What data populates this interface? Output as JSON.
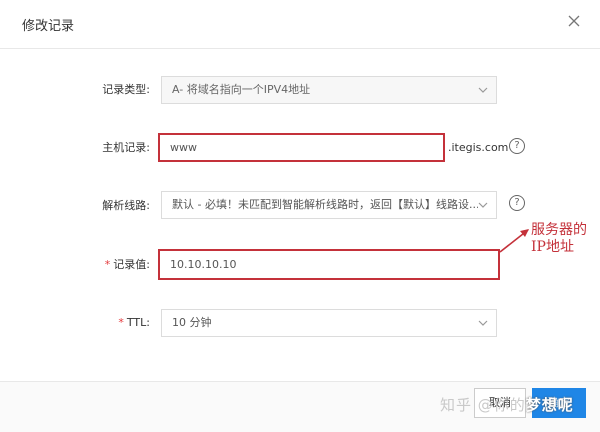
{
  "dialog": {
    "title": "修改记录",
    "close_icon": "close-icon"
  },
  "form": {
    "record_type": {
      "label": "记录类型:",
      "value": "A- 将域名指向一个IPV4地址"
    },
    "host": {
      "label": "主机记录:",
      "value": "www",
      "suffix": ".itegis.com"
    },
    "line": {
      "label": "解析线路:",
      "value": "默认 - 必填！未匹配到智能解析线路时，返回【默认】线路设..."
    },
    "record_value": {
      "required_mark": "*",
      "label": "记录值:",
      "value": "10.10.10.10"
    },
    "ttl": {
      "required_mark": "*",
      "label": "TTL:",
      "value": "10 分钟"
    }
  },
  "annotation": {
    "text_line1": "服务器的",
    "text_line2": "IP地址",
    "color": "#c4313a"
  },
  "footer": {
    "cancel_label": "取消",
    "ok_label": "确定"
  },
  "watermark": {
    "text": "知乎 @你的",
    "strong_text": "梦想呢"
  }
}
